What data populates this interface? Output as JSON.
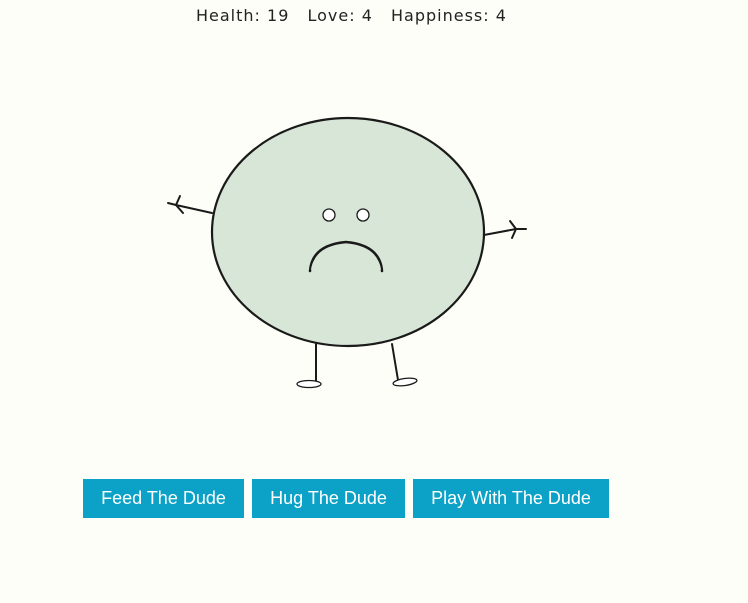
{
  "stats": {
    "health_label": "Health:",
    "health_value": "19",
    "love_label": "Love:",
    "love_value": "4",
    "happiness_label": "Happiness:",
    "happiness_value": "4"
  },
  "dude": {
    "body_color": "#d7e6d6",
    "outline_color": "#1a1a1a",
    "mood": "sad"
  },
  "actions": {
    "feed_label": "Feed The Dude",
    "hug_label": "Hug The Dude",
    "play_label": "Play With The Dude",
    "button_color": "#0ca1c7"
  }
}
